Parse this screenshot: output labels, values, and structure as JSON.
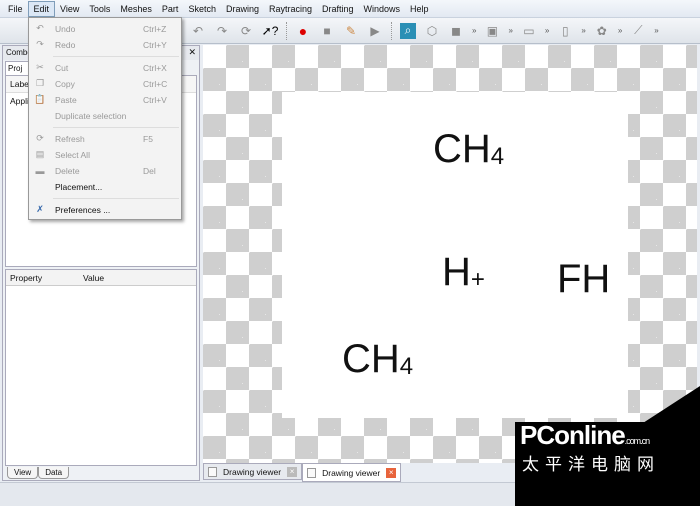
{
  "menubar": [
    "File",
    "Edit",
    "View",
    "Tools",
    "Meshes",
    "Part",
    "Sketch",
    "Drawing",
    "Raytracing",
    "Drafting",
    "Windows",
    "Help"
  ],
  "edit_menu": [
    {
      "label": "Undo",
      "shortcut": "Ctrl+Z",
      "icon": "undo-icon",
      "enabled": false
    },
    {
      "label": "Redo",
      "shortcut": "Ctrl+Y",
      "icon": "redo-icon",
      "enabled": false
    },
    {
      "label": "Cut",
      "shortcut": "Ctrl+X",
      "icon": "cut-icon",
      "enabled": false
    },
    {
      "label": "Copy",
      "shortcut": "Ctrl+C",
      "icon": "copy-icon",
      "enabled": false
    },
    {
      "label": "Paste",
      "shortcut": "Ctrl+V",
      "icon": "paste-icon",
      "enabled": false
    },
    {
      "label": "Duplicate selection",
      "shortcut": "",
      "icon": "",
      "enabled": false
    },
    {
      "label": "Refresh",
      "shortcut": "F5",
      "icon": "refresh-icon",
      "enabled": false
    },
    {
      "label": "Select All",
      "shortcut": "",
      "icon": "select-all-icon",
      "enabled": false
    },
    {
      "label": "Delete",
      "shortcut": "Del",
      "icon": "delete-icon",
      "enabled": false
    },
    {
      "label": "Placement...",
      "shortcut": "",
      "icon": "",
      "enabled": true
    },
    {
      "label": "Preferences ...",
      "shortcut": "",
      "icon": "preferences-icon",
      "enabled": true
    }
  ],
  "left": {
    "title": "Combo",
    "tab": "Proj",
    "tree_header": "Label",
    "tree_item": "Appli",
    "props_headers": [
      "Property",
      "Value"
    ],
    "bottom_tabs": [
      "View",
      "Data"
    ]
  },
  "drawing": {
    "formulas": [
      {
        "base": "CH",
        "sub": "4"
      },
      {
        "base": "H",
        "sup": "+"
      },
      {
        "base": "FH"
      },
      {
        "base": "CH",
        "sub": "4"
      }
    ]
  },
  "viewer_tabs": [
    "Drawing viewer",
    "Drawing viewer"
  ],
  "watermark": {
    "brand": "PConline",
    "domain": ".com.cn",
    "cn": "太平洋电脑网"
  }
}
